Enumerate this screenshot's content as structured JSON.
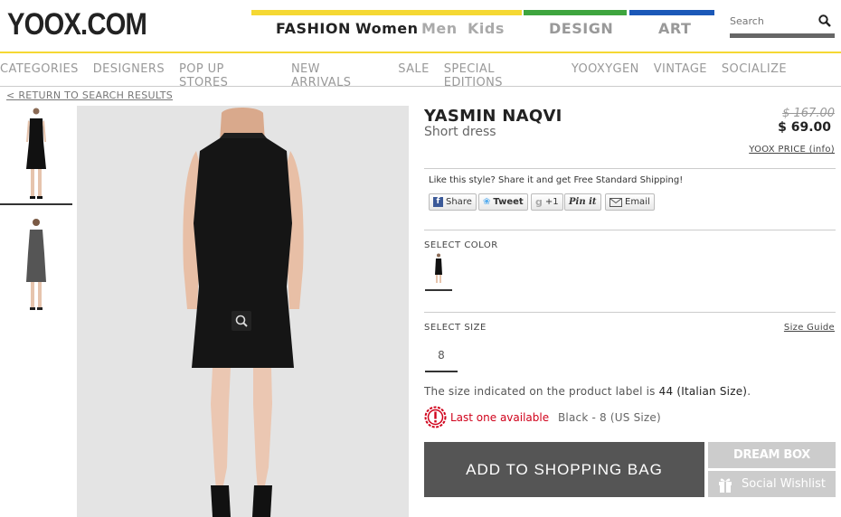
{
  "header": {
    "logo": "YOOX.COM",
    "nav": {
      "fashion": "FASHION",
      "women": "Women",
      "men": "Men",
      "kids": "Kids",
      "design": "DESIGN",
      "art": "ART"
    },
    "search_placeholder": "Search",
    "colors": {
      "fashion_bar": "#f5d833",
      "design_bar": "#3ea53e",
      "art_bar": "#1b58b8"
    }
  },
  "categories": [
    "CATEGORIES",
    "DESIGNERS",
    "POP UP STORES",
    "NEW ARRIVALS",
    "SALE",
    "SPECIAL EDITIONS",
    "YOOXYGEN",
    "VINTAGE",
    "SOCIALIZE"
  ],
  "back_link": "< RETURN TO SEARCH RESULTS",
  "product": {
    "brand": "YASMIN NAQVI",
    "subtitle": "Short dress",
    "old_price": "$ 167.00",
    "price": "$ 69.00",
    "yoox_price_link": "YOOX PRICE (info)",
    "share_text": "Like this style? Share it and get Free Standard Shipping!",
    "share_buttons": {
      "facebook": "Share",
      "twitter": "Tweet",
      "gplus": "+1",
      "pinterest": "Pin it",
      "email": "Email"
    },
    "select_color_label": "SELECT COLOR",
    "select_size_label": "SELECT SIZE",
    "size_guide": "Size Guide",
    "size_option": "8",
    "size_note_prefix": "The size indicated on the product label is",
    "size_note_value": "44 (Italian Size)",
    "size_note_suffix": ".",
    "availability": "Last one available",
    "availability_detail": "Black - 8 (US Size)",
    "add_to_bag": "ADD TO SHOPPING BAG",
    "dream_box": "DREAM BOX",
    "social_wishlist": "Social Wishlist"
  }
}
